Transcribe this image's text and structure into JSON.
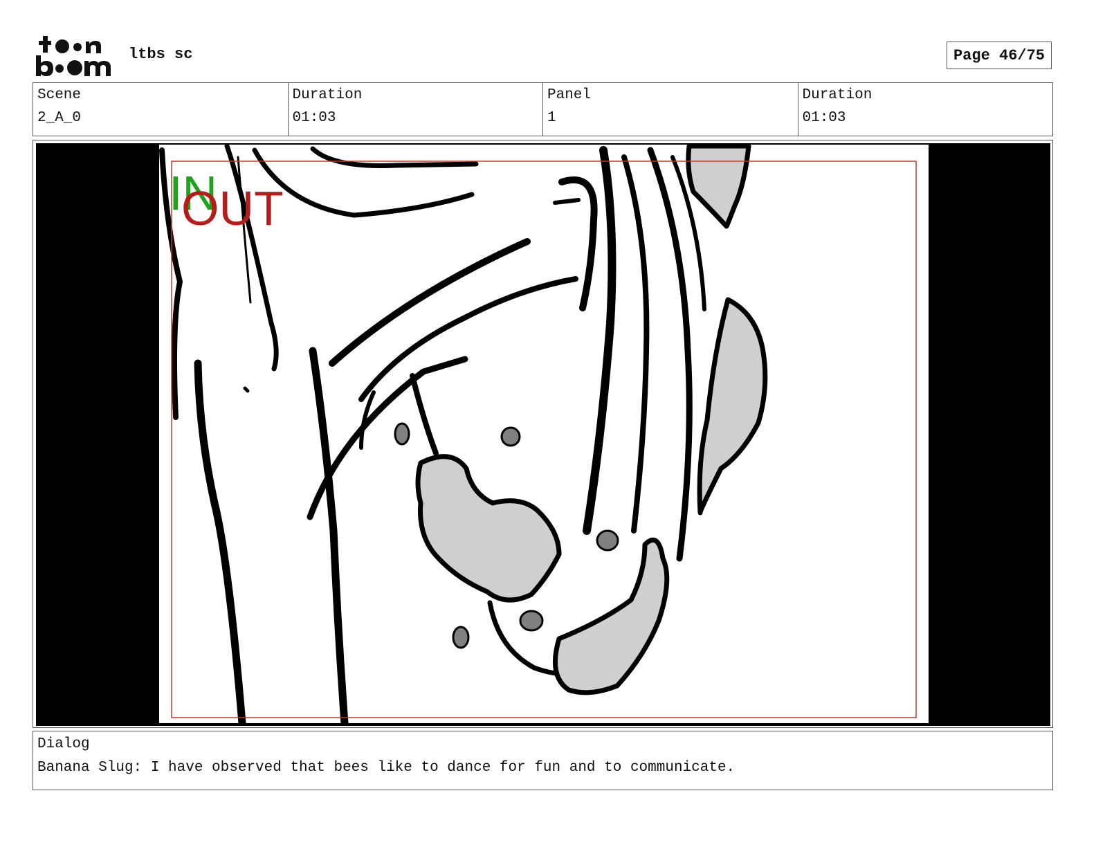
{
  "header": {
    "logo_text": "toon boom",
    "project_name": "ltbs sc",
    "page_label": "Page 46/75"
  },
  "info": {
    "scene_label": "Scene",
    "scene_value": "2_A_0",
    "scene_duration_label": "Duration",
    "scene_duration_value": "01:03",
    "panel_label": "Panel",
    "panel_value": "1",
    "panel_duration_label": "Duration",
    "panel_duration_value": "01:03"
  },
  "panel": {
    "in_marker": "IN",
    "out_marker": "OUT",
    "colors": {
      "in": "#1fa31f",
      "out": "#b51c1c",
      "safe_frame": "#c0392b",
      "fill": "#cfcfcf",
      "pebble": "#808080"
    }
  },
  "dialog": {
    "label": "Dialog",
    "text": "Banana Slug: I have observed that bees like to dance for fun and to communicate."
  }
}
